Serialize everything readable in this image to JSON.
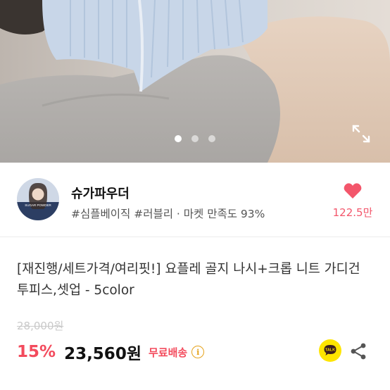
{
  "gallery": {
    "slide_count": 3,
    "active_slide": 1
  },
  "icons": {
    "expand": "expand-icon",
    "heart": "heart-icon",
    "talk": "kakao-talk-icon",
    "share": "share-icon",
    "info": "info-icon"
  },
  "seller": {
    "name": "슈가파우더",
    "tags": "#심플베이직 #러블리 · 마켓 만족도 93%",
    "avatar_text": "SUGAR POWDER"
  },
  "like": {
    "count": "122.5만"
  },
  "product": {
    "title": "[재진행/세트가격/여리핏!] 요플레 골지 나시+크롭 니트 가디건 투피스,셋업 - 5color",
    "original_price": "28,000원",
    "discount": "15%",
    "price": "23,560원",
    "shipping": "무료배송",
    "talk_label": "TALK"
  },
  "colors": {
    "accent": "#f34b5d",
    "heart": "#f3566b",
    "talk_bg": "#fee500",
    "info": "#e5a21a"
  }
}
